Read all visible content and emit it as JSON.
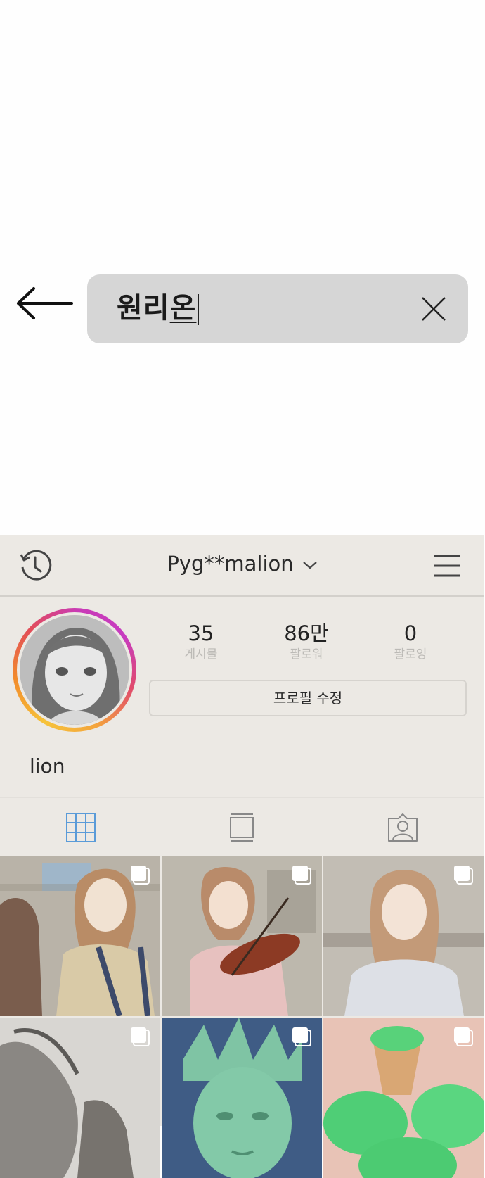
{
  "search": {
    "text_main": "원리",
    "text_last": "온"
  },
  "profile": {
    "username": "Pyg**malion",
    "stats": [
      {
        "value": "35",
        "label": "게시물"
      },
      {
        "value": "86만",
        "label": "팔로워"
      },
      {
        "value": "0",
        "label": "팔로잉"
      }
    ],
    "edit_button": "프로필 수정",
    "bio": "lion"
  },
  "colors": {
    "panel_bg": "#ece9e4",
    "grid_tab_active": "#5a9bd8",
    "search_bg": "#d6d6d6"
  },
  "icons": {
    "back": "arrow-left-icon",
    "clear": "close-icon",
    "history": "history-icon",
    "dropdown": "chevron-down-icon",
    "menu": "hamburger-menu-icon",
    "tab_grid": "grid-icon",
    "tab_feed": "feed-icon",
    "tab_tagged": "tagged-person-icon",
    "multi": "multiple-posts-icon"
  }
}
